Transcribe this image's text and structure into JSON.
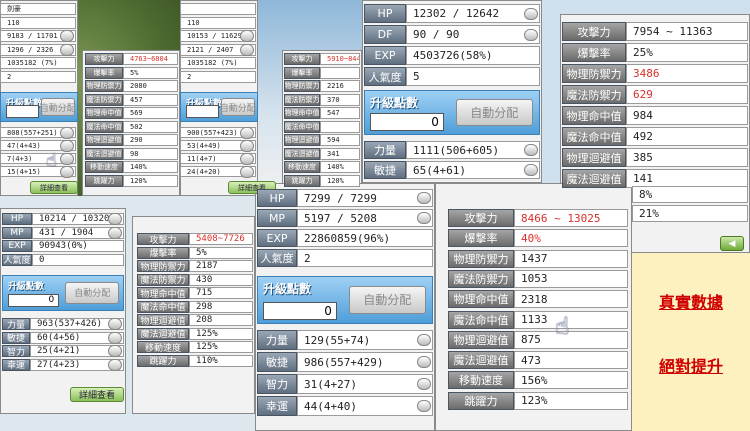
{
  "ss1": {
    "left_rows": [
      "劍豪",
      "110",
      "9183 / 11701",
      "1296 / 2326",
      "1035182 (7%)",
      "2"
    ],
    "ap_title": "升級點數",
    "auto_label": "自動分配",
    "bottom_rows": [
      "808(557+251)",
      "47(4+43)",
      "7(4+3)",
      "15(4+15)"
    ],
    "detail_button": "詳細查看",
    "right_labels": [
      "攻擊力",
      "爆擊率",
      "物理防禦力",
      "魔法防禦力",
      "物理命中值",
      "魔法命中值",
      "物理迴避值",
      "魔法迴避值",
      "移動速度",
      "跳躍力"
    ],
    "right_values": [
      "4763~6804",
      "5%",
      "2080",
      "457",
      "569",
      "502",
      "290",
      "98",
      "140%",
      "120%"
    ]
  },
  "ss2": {
    "left_rows": [
      "",
      "110",
      "10153 / 11629",
      "2121 / 2407",
      "1035182 (7%)",
      "2"
    ],
    "ap_title": "升級點數",
    "auto_label": "自動分配",
    "bottom_rows": [
      "900(557+423)",
      "53(4+49)",
      "11(4+7)",
      "24(4+20)"
    ],
    "detail_button": "詳細查看",
    "right_labels": [
      "攻擊力",
      "爆擊率",
      "物理防禦力",
      "魔法防禦力",
      "物理命中值",
      "魔法命中值",
      "物理迴避值",
      "魔法迴避值",
      "移動速度",
      "跳躍力"
    ],
    "right_values": [
      "5910~8443",
      "",
      "2216",
      "370",
      "547",
      "",
      "594",
      "341",
      "140%",
      "120%"
    ]
  },
  "ss3": {
    "rows": [
      {
        "label": "HP",
        "value": "12302 / 12642"
      },
      {
        "label": "DF",
        "value": "90 / 90"
      },
      {
        "label": "EXP",
        "value": "4503726(58%)"
      },
      {
        "label": "人氣度",
        "value": "5"
      }
    ],
    "ap_title": "升級點數",
    "ap_value": "0",
    "auto_label": "自動分配",
    "bottom": [
      {
        "label": "力量",
        "value": "1111(506+605)"
      },
      {
        "label": "敏捷",
        "value": "65(4+61)"
      }
    ],
    "right": [
      {
        "label": "攻擊力",
        "value": "7954 ~ 11363"
      },
      {
        "label": "爆擊率",
        "value": "25%"
      },
      {
        "label": "物理防禦力",
        "value": "3486"
      },
      {
        "label": "魔法防禦力",
        "value": "629"
      },
      {
        "label": "物理命中值",
        "value": "984"
      },
      {
        "label": "魔法命中值",
        "value": "492"
      },
      {
        "label": "物理迴避值",
        "value": "385"
      },
      {
        "label": "魔法迴避值",
        "value": "141"
      }
    ],
    "tail": [
      "8%",
      "21%"
    ]
  },
  "ss4": {
    "rows": [
      {
        "label": "HP",
        "value": "10214 / 10320"
      },
      {
        "label": "MP",
        "value": "431 / 1904"
      },
      {
        "label": "EXP",
        "value": "90943(0%)"
      },
      {
        "label": "人氣度",
        "value": "0"
      }
    ],
    "ap_title": "升級點數",
    "ap_value": "0",
    "auto_label": "自動分配",
    "bottom": [
      {
        "label": "力量",
        "value": "963(537+426)"
      },
      {
        "label": "敏捷",
        "value": "60(4+56)"
      },
      {
        "label": "智力",
        "value": "25(4+21)"
      },
      {
        "label": "幸運",
        "value": "27(4+23)"
      }
    ],
    "detail_button": "詳細查看",
    "right": [
      {
        "label": "攻擊力",
        "value": "5408~7726"
      },
      {
        "label": "爆擊率",
        "value": "5%"
      },
      {
        "label": "物理防禦力",
        "value": "2187"
      },
      {
        "label": "魔法防禦力",
        "value": "430"
      },
      {
        "label": "物理命中值",
        "value": "715"
      },
      {
        "label": "魔法命中值",
        "value": "298"
      },
      {
        "label": "物理迴避值",
        "value": "208"
      },
      {
        "label": "魔法迴避值",
        "value": "125%"
      },
      {
        "label": "移動速度",
        "value": "125%"
      },
      {
        "label": "跳躍力",
        "value": "110%"
      }
    ]
  },
  "ss5": {
    "rows": [
      {
        "label": "HP",
        "value": "7299 / 7299"
      },
      {
        "label": "MP",
        "value": "5197 / 5208"
      },
      {
        "label": "EXP",
        "value": "22860859(96%)"
      },
      {
        "label": "人氣度",
        "value": "2"
      }
    ],
    "ap_title": "升級點數",
    "ap_value": "0",
    "auto_label": "自動分配",
    "bottom": [
      {
        "label": "力量",
        "value": "129(55+74)"
      },
      {
        "label": "敏捷",
        "value": "986(557+429)"
      },
      {
        "label": "智力",
        "value": "31(4+27)"
      },
      {
        "label": "幸運",
        "value": "44(4+40)"
      }
    ]
  },
  "ss6": {
    "right": [
      {
        "label": "攻擊力",
        "value": "8466 ~ 13025"
      },
      {
        "label": "爆擊率",
        "value": "40%"
      },
      {
        "label": "物理防禦力",
        "value": "1437"
      },
      {
        "label": "魔法防禦力",
        "value": "1053"
      },
      {
        "label": "物理命中值",
        "value": "2318"
      },
      {
        "label": "魔法命中值",
        "value": "1133"
      },
      {
        "label": "物理迴避值",
        "value": "875"
      },
      {
        "label": "魔法迴避值",
        "value": "473"
      },
      {
        "label": "移動速度",
        "value": "156%"
      },
      {
        "label": "跳躍力",
        "value": "123%"
      }
    ]
  },
  "promo": {
    "line1": "真實數據",
    "line2": "絕對提升"
  },
  "colors": {
    "red": "#d8302a",
    "promo_bg": "#fdf1c0",
    "promo_text": "#d00000"
  }
}
